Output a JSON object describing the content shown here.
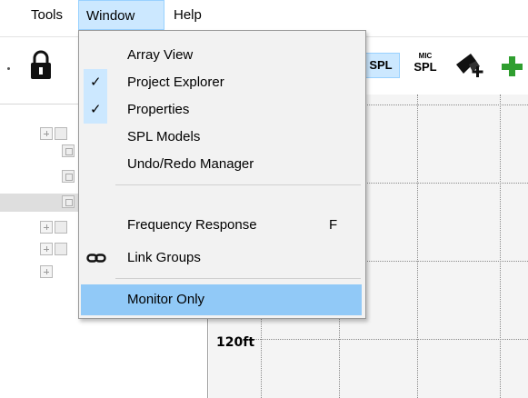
{
  "menubar": {
    "items": [
      {
        "label": "Tools"
      },
      {
        "label": "Window"
      },
      {
        "label": "Help"
      }
    ]
  },
  "toolbar": {
    "spl_label": "SPL",
    "mic_label": "MIC",
    "micspl_label": "SPL"
  },
  "window_menu": {
    "items": [
      {
        "label": "Array View",
        "checked": false
      },
      {
        "label": "Project Explorer",
        "checked": true
      },
      {
        "label": "Properties",
        "checked": true
      },
      {
        "label": "SPL Models",
        "checked": false
      },
      {
        "label": "Undo/Redo Manager",
        "checked": false
      },
      {
        "label": "Frequency Response",
        "shortcut": "F"
      },
      {
        "label": "Link Groups",
        "icon": "link-icon"
      },
      {
        "label": "Monitor Only",
        "highlighted": true
      }
    ]
  },
  "plot": {
    "distance_label": "120ft"
  },
  "colors": {
    "menu_highlight": "#91c9f7",
    "check_background": "#cce8ff",
    "add_green": "#2f9e2f"
  }
}
